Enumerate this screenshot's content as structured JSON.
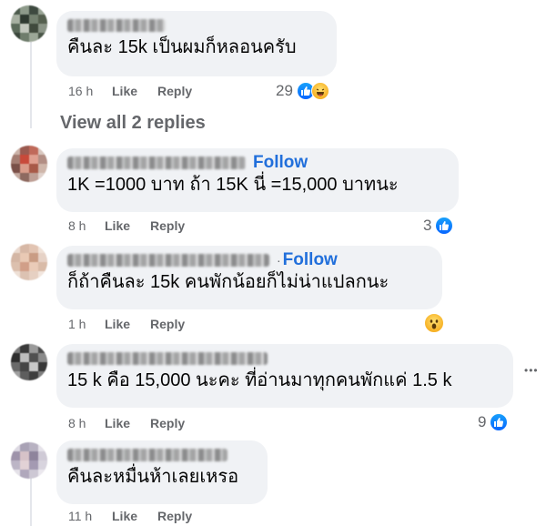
{
  "colors": {
    "bubble": "#f0f2f5",
    "link": "#216fdb",
    "meta": "#65676b",
    "like": "#0866ff"
  },
  "actions": {
    "like": "Like",
    "reply": "Reply"
  },
  "view_replies": "View all 2 replies",
  "more_label": "•••",
  "comments": [
    {
      "follow": "",
      "text": "คืนละ 15k เป็นผมก็หลอนครับ",
      "time": "16 h",
      "reaction_count": "29",
      "reactions": [
        "like-icon",
        "haha-icon"
      ]
    },
    {
      "follow": "Follow",
      "text": "1K =1000 บาท ถ้า 15K นี่ =15,000 บาทนะ",
      "time": "8 h",
      "reaction_count": "3",
      "reactions": [
        "like-icon"
      ]
    },
    {
      "follow": "Follow",
      "text": "ก็ถ้าคืนละ 15k คนพักน้อยก็ไม่น่าแปลกนะ",
      "time": "1 h",
      "reaction_count": "",
      "reactions": [
        "wow-icon"
      ]
    },
    {
      "follow": "",
      "text": "15 k คือ 15,000 นะคะ ที่อ่านมาทุกคนพักแค่ 1.5 k",
      "time": "8 h",
      "reaction_count": "9",
      "reactions": [
        "like-icon"
      ]
    },
    {
      "follow": "",
      "text": "คืนละหมื่นห้าเลยเหรอ",
      "time": "11 h",
      "reaction_count": "",
      "reactions": []
    }
  ]
}
